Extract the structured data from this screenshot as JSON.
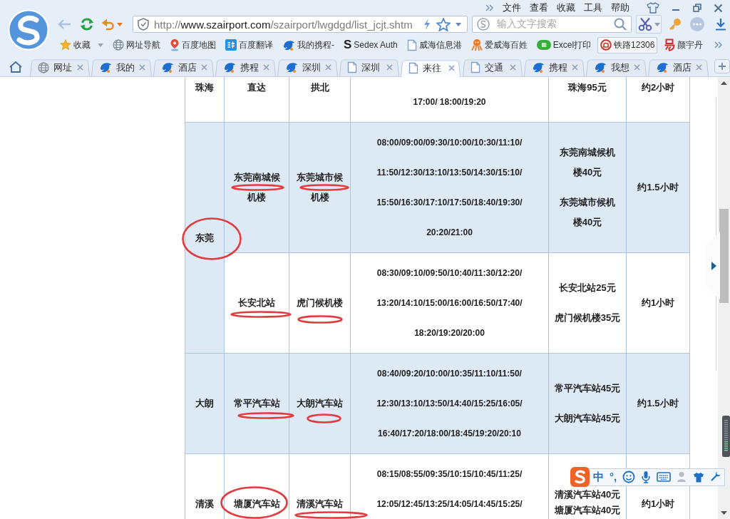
{
  "menu_bar": {
    "items": [
      "文件",
      "查看",
      "收藏",
      "工具",
      "帮助"
    ]
  },
  "address_bar": {
    "scheme": "http://",
    "domain": "www.szairport.com",
    "path": "/szairport/lwgdgd/list_jcjt.shtm"
  },
  "search_box": {
    "placeholder": "输入文字搜索"
  },
  "bookmarks": [
    {
      "label": "收藏",
      "menu": true,
      "highlighted": false
    },
    {
      "label": "网址导航",
      "menu": false,
      "highlighted": false
    },
    {
      "label": "百度地图",
      "menu": false,
      "highlighted": false
    },
    {
      "label": "百度翻译",
      "menu": false,
      "highlighted": false
    },
    {
      "label": "我的携程-",
      "menu": false,
      "highlighted": false
    },
    {
      "label": "Sedex Auth",
      "icon_letter": "S",
      "menu": false,
      "highlighted": false
    },
    {
      "label": "威海信息港",
      "menu": false,
      "highlighted": false
    },
    {
      "label": "爱威海百姓",
      "menu": false,
      "highlighted": false
    },
    {
      "label": "Excel打印",
      "menu": false,
      "highlighted": false
    },
    {
      "label": "铁路12306",
      "menu": false,
      "highlighted": true
    },
    {
      "label": "颜宇丹",
      "menu": false,
      "highlighted": false
    }
  ],
  "tabs": [
    {
      "label": "网址",
      "selected": false
    },
    {
      "label": "我的",
      "selected": false
    },
    {
      "label": "酒店",
      "selected": false
    },
    {
      "label": "携程",
      "selected": false
    },
    {
      "label": "深圳",
      "selected": false
    },
    {
      "label": "深圳",
      "selected": false
    },
    {
      "label": "来往",
      "selected": true
    },
    {
      "label": "交通",
      "selected": false
    },
    {
      "label": "携程",
      "selected": false
    },
    {
      "label": "我想",
      "selected": false
    },
    {
      "label": "酒店",
      "selected": false
    }
  ],
  "schedule": {
    "groups": [
      {
        "column_1": "珠海",
        "routes": [
          {
            "column_2": [
              "直达"
            ],
            "column_3": [
              "拱北"
            ],
            "column_4": [
              "17:00/ 18:00/19:20"
            ],
            "column_5": [
              [
                "珠海95元"
              ]
            ],
            "column_6": "约2小时"
          }
        ]
      },
      {
        "column_1": "东莞",
        "routes": [
          {
            "column_2": [
              "东莞南城候",
              "机楼"
            ],
            "column_3": [
              "东莞城市候",
              "机楼"
            ],
            "column_4": [
              "08:00/09:00/09:30/10:00/10:30/11:10/",
              "11:50/12:30/13:10/13:50/14:30/15:10/",
              "15:50/16:30/17:10/17:50/18:40/19:30/",
              "20:20/21:00"
            ],
            "column_5": [
              [
                "东莞南城候机",
                "楼40元"
              ],
              [
                "东莞城市候机",
                "楼40元"
              ]
            ],
            "column_6": "约1.5小时"
          },
          {
            "column_2": [
              "长安北站"
            ],
            "column_3": [
              "虎门候机楼"
            ],
            "column_4": [
              "08:30/09:10/09:50/10:40/11:30/12:20/",
              "13:20/14:10/15:00/16:00/16:50/17:40/",
              "18:20/19:20/20:00"
            ],
            "column_5": [
              [
                "长安北站25元"
              ],
              [
                "虎门候机楼35元"
              ]
            ],
            "column_6": "约1小时"
          }
        ]
      },
      {
        "column_1": "大朗",
        "routes": [
          {
            "column_2": [
              "常平汽车站"
            ],
            "column_3": [
              "大朗汽车站"
            ],
            "column_4": [
              "08:40/09:20/10:00/10:35/11:10/11:50/",
              "12:30/13:10/13:50/14:40/15:25/16:05/",
              "16:40/17:20/18:00/18:45/19:20/20:10"
            ],
            "column_5": [
              [
                "常平汽车站45元"
              ],
              [
                "大朗汽车站45元"
              ]
            ],
            "column_6": "约1.5小时"
          }
        ]
      },
      {
        "column_1": "清溪",
        "routes": [
          {
            "column_2": [
              "塘厦汽车站"
            ],
            "column_3": [
              "清溪汽车站"
            ],
            "column_4": [
              "08:15/08:55/09:35/10:15/10:45/11:25/",
              "12:05/12:45/13:25/14:05/14:45/15:25/"
            ],
            "column_5": [
              [
                "清溪汽车站40元"
              ],
              [
                "塘厦汽车站40元"
              ]
            ],
            "column_6": "约1小时"
          }
        ]
      }
    ]
  },
  "ime_toolbar": {
    "mode": "中",
    "punctuation": "°,"
  }
}
